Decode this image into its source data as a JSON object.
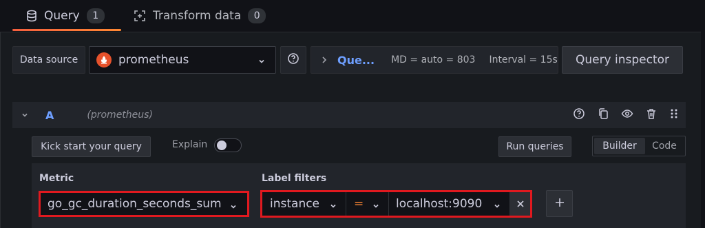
{
  "tabs": [
    {
      "label": "Query",
      "count": "1",
      "icon": "database-icon",
      "active": true
    },
    {
      "label": "Transform data",
      "count": "0",
      "icon": "transform-icon",
      "active": false
    }
  ],
  "options_row": {
    "datasource_label": "Data source",
    "datasource_value": "prometheus",
    "query_options_link": "Que...",
    "md_text": "MD = auto = 803",
    "interval_text": "Interval = 15s",
    "query_inspector_label": "Query inspector"
  },
  "query": {
    "ref_id": "A",
    "datasource_name": "(prometheus)"
  },
  "toolbar": {
    "kick_start_label": "Kick start your query",
    "explain_label": "Explain",
    "explain_on": false,
    "run_queries_label": "Run queries",
    "modes": [
      "Builder",
      "Code"
    ],
    "active_mode": "Builder"
  },
  "builder": {
    "metric_label": "Metric",
    "metric_value": "go_gc_duration_seconds_sum",
    "label_filters_label": "Label filters",
    "filter": {
      "key": "instance",
      "op": "=",
      "value": "localhost:9090"
    }
  },
  "colors": {
    "accent_gradient": [
      "#f55f3e",
      "#ff8833"
    ],
    "link_blue": "#6e9fff",
    "highlight_red": "#e0191f"
  }
}
